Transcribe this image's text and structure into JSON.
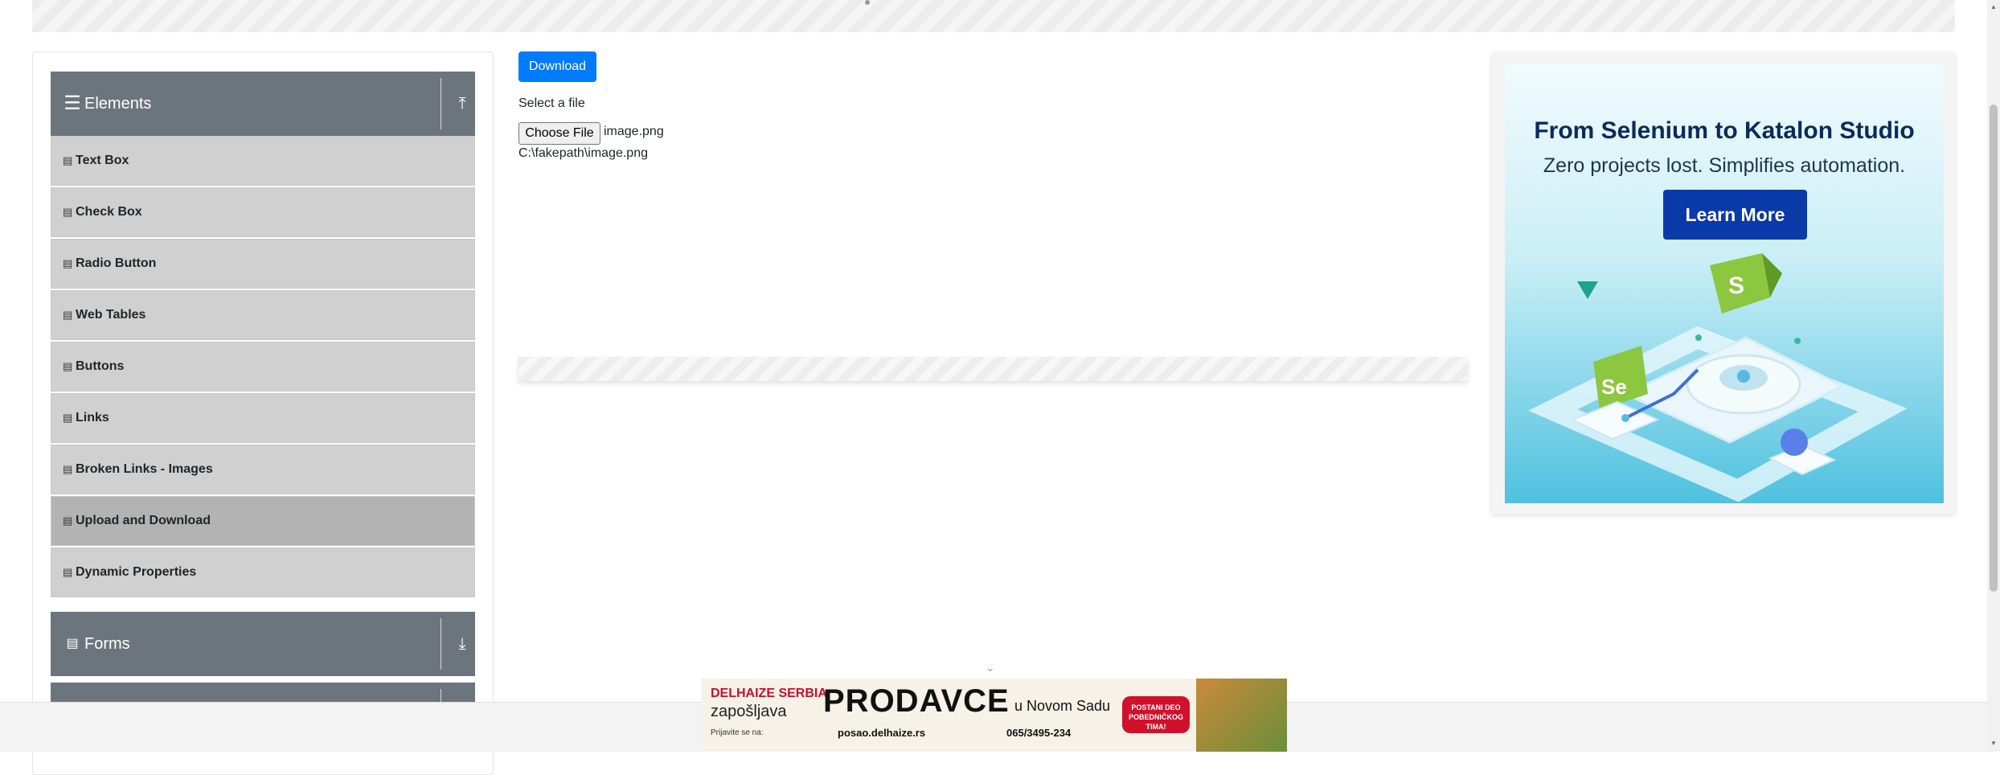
{
  "sidebar": {
    "elements_header": "Elements",
    "items": [
      {
        "label": "Text Box"
      },
      {
        "label": "Check Box"
      },
      {
        "label": "Radio Button"
      },
      {
        "label": "Web Tables"
      },
      {
        "label": "Buttons"
      },
      {
        "label": "Links"
      },
      {
        "label": "Broken Links - Images"
      },
      {
        "label": "Upload and Download"
      },
      {
        "label": "Dynamic Properties"
      }
    ],
    "forms_header": "Forms",
    "active_item": "Upload and Download"
  },
  "main": {
    "download_label": "Download",
    "select_label": "Select a file",
    "choose_file_label": "Choose File",
    "file_name": "image.png",
    "file_path": "C:\\fakepath\\image.png"
  },
  "ad_right": {
    "title": "From Selenium to Katalon Studio",
    "subtitle": "Zero projects lost. Simplifies automation.",
    "button": "Learn More",
    "logo_a": "S",
    "logo_b": "Se"
  },
  "ad_bottom": {
    "brand": "DELHAIZE SERBIA",
    "tagline": "zapošljava",
    "headline": "PRODAVCE",
    "city": "u Novom Sadu",
    "apply": "Prijavite se na:",
    "site": "posao.delhaize.rs",
    "phone": "065/3495-234",
    "badge": "POSTANI DEO POBEDNIČKOG TIMA!"
  },
  "colors": {
    "accent": "#007bff",
    "sidebar_header": "#6c757d",
    "menu_item": "#d0d0d0",
    "menu_item_active": "#b3b3b3",
    "ad_button": "#0a3aa8"
  }
}
